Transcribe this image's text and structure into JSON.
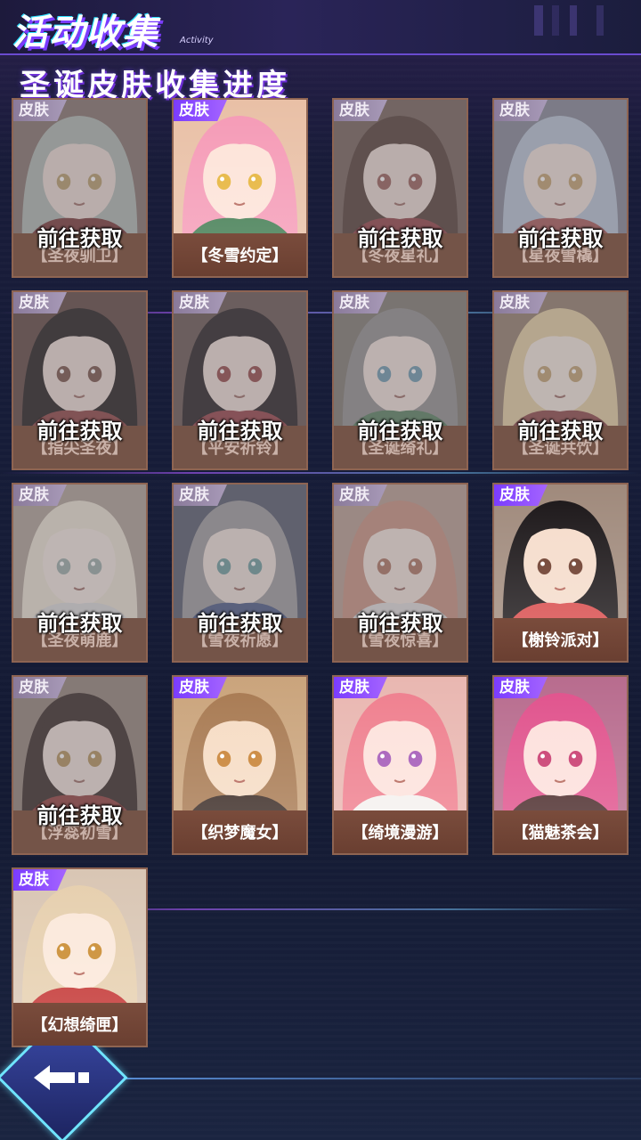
{
  "header": {
    "title": "活动收集",
    "title_en": "Activity",
    "subtitle": "圣诞皮肤收集进度"
  },
  "badge_label": "皮肤",
  "goto_label": "前往获取",
  "cards": [
    {
      "name": "【圣夜驯卫】",
      "owned": false,
      "hair": "#a6b9b1",
      "skin": "#f2dccd",
      "accent": "#9b2b2b",
      "bg": "#8b6f64",
      "eyes": "#c89a40"
    },
    {
      "name": "【冬雪约定】",
      "owned": true,
      "hair": "#f59ab6",
      "skin": "#fde3d8",
      "accent": "#3f7a4f",
      "bg": "#e9c0a6",
      "eyes": "#e6b43a"
    },
    {
      "name": "【冬夜星礼】",
      "owned": false,
      "hair": "#5a3b2e",
      "skin": "#f3dccc",
      "accent": "#c0333a",
      "bg": "#7d5d52",
      "eyes": "#b9554c"
    },
    {
      "name": "【星夜雪橇】",
      "owned": false,
      "hair": "#a9c6e8",
      "skin": "#f6e2d6",
      "accent": "#d64b4b",
      "bg": "#7b88a3",
      "eyes": "#d9a044"
    },
    {
      "name": "【指尖圣夜】",
      "owned": false,
      "hair": "#1e1a1c",
      "skin": "#f4dccd",
      "accent": "#b83636",
      "bg": "#6a4038",
      "eyes": "#8a4a3a"
    },
    {
      "name": "【平安祈铃】",
      "owned": false,
      "hair": "#241d22",
      "skin": "#f6ded0",
      "accent": "#c8323a",
      "bg": "#6f5249",
      "eyes": "#c23a3a"
    },
    {
      "name": "【圣诞绮礼】",
      "owned": false,
      "hair": "#8e8f91",
      "skin": "#f6e2d6",
      "accent": "#3a8a50",
      "bg": "#7e7a6c",
      "eyes": "#4aa0c8"
    },
    {
      "name": "【圣诞共饮】",
      "owned": false,
      "hair": "#f2cf7e",
      "skin": "#fbe7d6",
      "accent": "#b53b3b",
      "bg": "#9d7c5a",
      "eyes": "#d3a048"
    },
    {
      "name": "【圣夜萌鹿】",
      "owned": false,
      "hair": "#efe4c8",
      "skin": "#f9e9dc",
      "accent": "#d9dbe0",
      "bg": "#b4a08e",
      "eyes": "#8ab0a8"
    },
    {
      "name": "【雪夜祈愿】",
      "owned": false,
      "hair": "#9b9ba3",
      "skin": "#f5e0d3",
      "accent": "#3a5aa8",
      "bg": "#495a7c",
      "eyes": "#4aa4a8"
    },
    {
      "name": "【雪夜惊喜】",
      "owned": false,
      "hair": "#e98a6a",
      "skin": "#fbe4d6",
      "accent": "#e0e0e0",
      "bg": "#c79a86",
      "eyes": "#d06a4a"
    },
    {
      "name": "【榭铃派对】",
      "owned": true,
      "hair": "#1b1618",
      "skin": "#f5dccb",
      "accent": "#d84a4a",
      "bg": "#a08a7c",
      "eyes": "#6a3a2a"
    },
    {
      "name": "【浮蕊初雪】",
      "owned": false,
      "hair": "#3a2620",
      "skin": "#f6e2d4",
      "accent": "#c2302e",
      "bg": "#9a8270",
      "eyes": "#c8902e"
    },
    {
      "name": "【织梦魔女】",
      "owned": true,
      "hair": "#a87a52",
      "skin": "#f6dcc4",
      "accent": "#3a2a24",
      "bg": "#caa47c",
      "eyes": "#c88234"
    },
    {
      "name": "【绮境漫游】",
      "owned": true,
      "hair": "#ef7f8e",
      "skin": "#fde2dc",
      "accent": "#f4f1ee",
      "bg": "#e9b7b1",
      "eyes": "#a45ab8"
    },
    {
      "name": "【猫魅茶会】",
      "owned": true,
      "hair": "#e0528c",
      "skin": "#fde0dc",
      "accent": "#4a2a2a",
      "bg": "#b86c8e",
      "eyes": "#c83a6e"
    },
    {
      "name": "【幻想绮匣】",
      "owned": true,
      "hair": "#e6cfae",
      "skin": "#fbe8da",
      "accent": "#c2302e",
      "bg": "#d9c6b4",
      "eyes": "#c98a2e"
    }
  ],
  "footer": {
    "back_icon": "back-arrow-icon"
  }
}
